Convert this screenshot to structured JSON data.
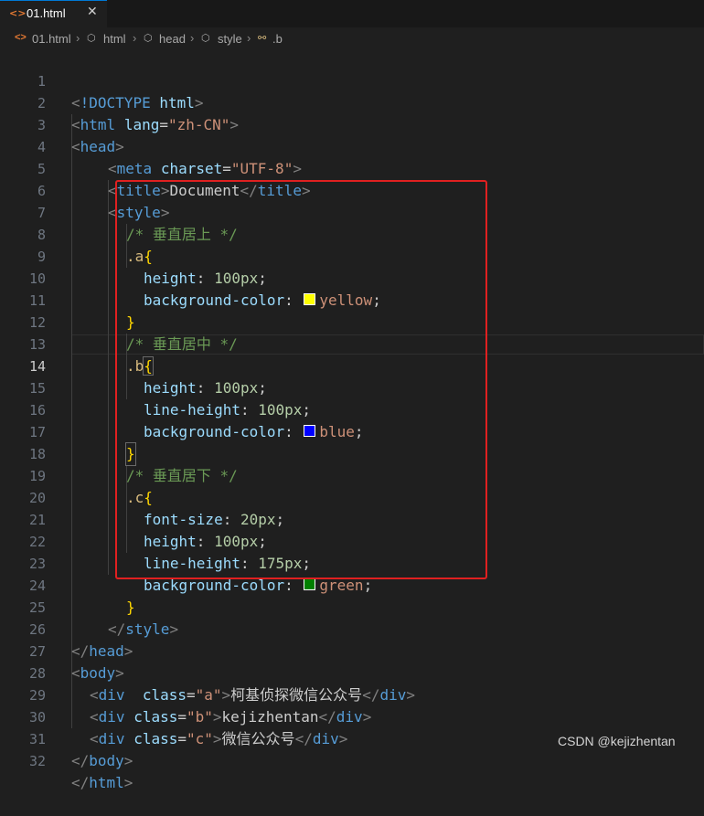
{
  "tab": {
    "icon": "html-file-icon",
    "label": "01.html",
    "close": "✕"
  },
  "breadcrumb": [
    "01.html",
    "html",
    "head",
    "style",
    ".b"
  ],
  "swatches": {
    "yellow": "#ffff00",
    "blue": "#0000ff",
    "green": "#008000"
  },
  "code": {
    "doctype": "!DOCTYPE",
    "html_kw": "html",
    "lang_attr": "lang",
    "lang_val": "\"zh-CN\"",
    "head": "head",
    "meta": "meta",
    "charset_attr": "charset",
    "charset_val": "\"UTF-8\"",
    "title": "title",
    "title_text": "Document",
    "style": "style",
    "comment_top": "/* 垂直居上 */",
    "sel_a": ".a",
    "comment_mid": "/* 垂直居中 */",
    "sel_b": ".b",
    "comment_bot": "/* 垂直居下 */",
    "sel_c": ".c",
    "prop_height": "height",
    "prop_bg": "background-color",
    "prop_lh": "line-height",
    "prop_fs": "font-size",
    "v100": "100px",
    "v20": "20px",
    "v175": "175px",
    "yellow": "yellow",
    "blue": "blue",
    "green": "green",
    "body": "body",
    "div": "div",
    "class_attr": "class",
    "class_a": "\"a\"",
    "class_b": "\"b\"",
    "class_c": "\"c\"",
    "text_a": "柯基侦探微信公众号",
    "text_b": "kejizhentan",
    "text_c": "微信公众号"
  },
  "line_numbers": [
    "1",
    "2",
    "3",
    "4",
    "5",
    "6",
    "7",
    "8",
    "9",
    "10",
    "11",
    "12",
    "13",
    "14",
    "15",
    "16",
    "17",
    "18",
    "19",
    "20",
    "21",
    "22",
    "23",
    "24",
    "25",
    "26",
    "27",
    "28",
    "29",
    "30",
    "31",
    "32"
  ],
  "current_line": "14",
  "watermark": "CSDN @kejizhentan"
}
